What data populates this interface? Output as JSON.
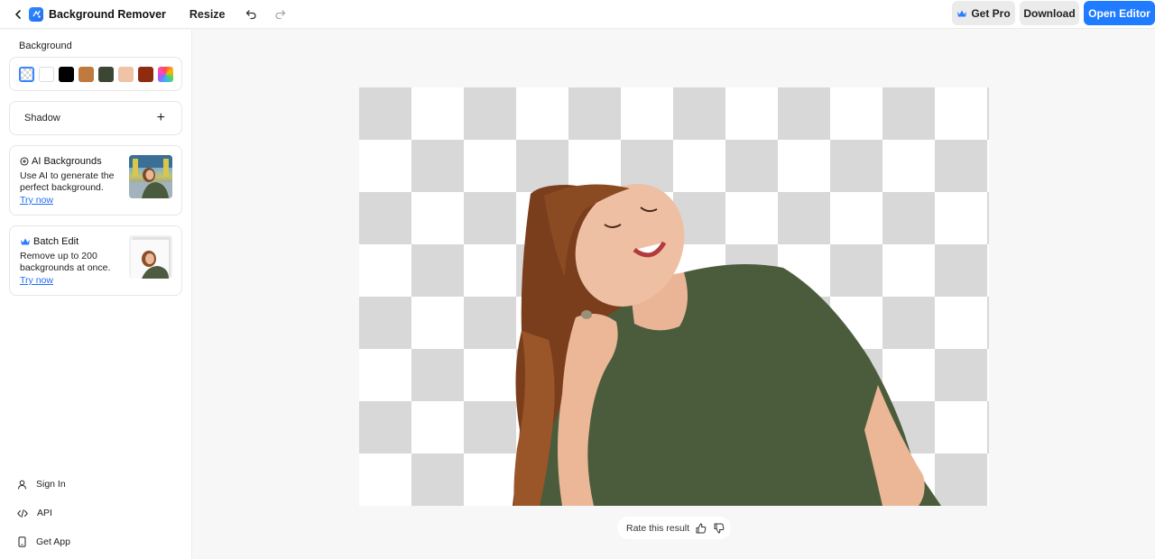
{
  "topbar": {
    "app_title": "Background Remover",
    "resize_label": "Resize",
    "get_pro_label": "Get Pro",
    "download_label": "Download",
    "open_editor_label": "Open Editor"
  },
  "sidebar": {
    "background_label": "Background",
    "swatches": [
      {
        "name": "transparent",
        "color": "transparent"
      },
      {
        "name": "white",
        "color": "#ffffff"
      },
      {
        "name": "black",
        "color": "#000000"
      },
      {
        "name": "brown",
        "color": "#c07a3e"
      },
      {
        "name": "dark-green",
        "color": "#3b4633"
      },
      {
        "name": "peach",
        "color": "#f0c2a6"
      },
      {
        "name": "rust",
        "color": "#8e2b10"
      },
      {
        "name": "rainbow",
        "color": "gradient"
      }
    ],
    "shadow_label": "Shadow",
    "ai_card": {
      "title": "AI Backgrounds",
      "desc": "Use AI to generate the perfect background.",
      "link": "Try now"
    },
    "batch_card": {
      "title": "Batch Edit",
      "desc": "Remove up to 200 backgrounds at once.",
      "link": "Try now"
    },
    "nav": {
      "sign_in": "Sign In",
      "api": "API",
      "get_app": "Get App"
    }
  },
  "rating": {
    "label": "Rate this result"
  },
  "colors": {
    "accent": "#1f7bff",
    "crown": "#2b7cff"
  }
}
